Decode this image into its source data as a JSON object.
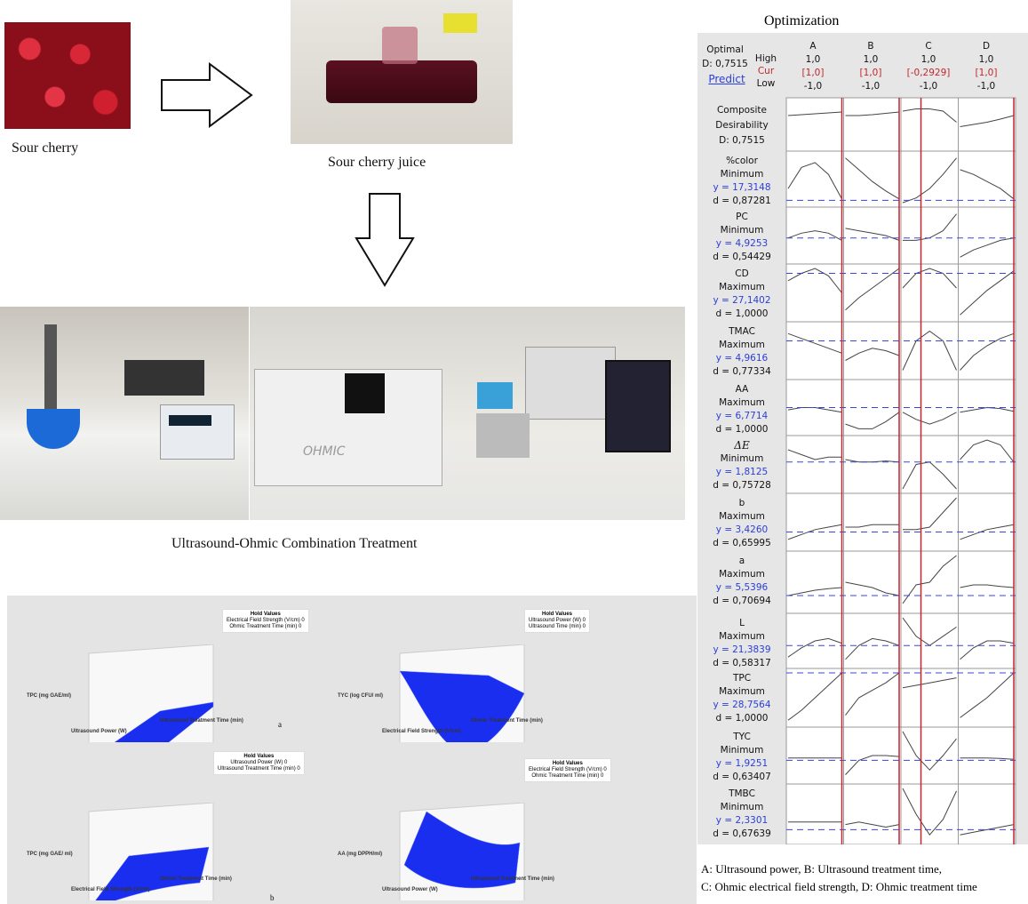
{
  "flow": {
    "sour_cherry": "Sour cherry",
    "juice": "Sour cherry juice",
    "treatment": "Ultrasound-Ohmic Combination Treatment",
    "ohmic_label": "OHMIC"
  },
  "optimization": {
    "title": "Optimization",
    "optimal": "Optimal",
    "D": "D: 0,7515",
    "predict": "Predict",
    "row_labels": {
      "high": "High",
      "cur": "Cur",
      "low": "Low"
    },
    "factors": [
      {
        "name": "A",
        "high": "1,0",
        "cur": "[1,0]",
        "low": "-1,0"
      },
      {
        "name": "B",
        "high": "1,0",
        "cur": "[1,0]",
        "low": "-1,0"
      },
      {
        "name": "C",
        "high": "1,0",
        "cur": "[-0,2929]",
        "low": "-1,0"
      },
      {
        "name": "D",
        "high": "1,0",
        "cur": "[1,0]",
        "low": "-1,0"
      }
    ],
    "composite": {
      "l1": "Composite",
      "l2": "Desirability",
      "l3": "D: 0,7515"
    },
    "responses": [
      {
        "name": "%color",
        "goal": "Minimum",
        "y": "y = 17,3148",
        "d": "d = 0,87281"
      },
      {
        "name": "PC",
        "goal": "Minimum",
        "y": "y = 4,9253",
        "d": "d = 0,54429"
      },
      {
        "name": "CD",
        "goal": "Maximum",
        "y": "y = 27,1402",
        "d": "d = 1,0000"
      },
      {
        "name": "TMAC",
        "goal": "Maximum",
        "y": "y = 4,9616",
        "d": "d = 0,77334"
      },
      {
        "name": "AA",
        "goal": "Maximum",
        "y": "y = 6,7714",
        "d": "d = 1,0000"
      },
      {
        "name": "ΔE",
        "goal": "Minimum",
        "y": "y = 1,8125",
        "d": "d = 0,75728"
      },
      {
        "name": "b",
        "goal": "Maximum",
        "y": "y = 3,4260",
        "d": "d = 0,65995"
      },
      {
        "name": "a",
        "goal": "Maximum",
        "y": "y = 5,5396",
        "d": "d = 0,70694"
      },
      {
        "name": "L",
        "goal": "Maximum",
        "y": "y = 21,3839",
        "d": "d = 0,58317"
      },
      {
        "name": "TPC",
        "goal": "Maximum",
        "y": "y = 28,7564",
        "d": "d = 1,0000"
      },
      {
        "name": "TYC",
        "goal": "Minimum",
        "y": "y = 1,9251",
        "d": "d = 0,63407"
      },
      {
        "name": "TMBC",
        "goal": "Minimum",
        "y": "y = 2,3301",
        "d": "d = 0,67639"
      }
    ],
    "legend1": "A: Ultrasound power, B: Ultrasound treatment time,",
    "legend2": "C: Ohmic electrical field strength, D: Ohmic treatment time",
    "colors": {
      "cur": "#c0272d",
      "y": "#2b3fd6",
      "bg": "#e6e6e6"
    }
  },
  "surfaces": {
    "a_label": "a",
    "b_label": "b",
    "plots": [
      {
        "hold_title": "Hold Values",
        "hold1": "Electrical Field Strength (V/cm)  0",
        "hold2": "Ohmic Treatment Time (min)  0",
        "z": "TPC (mg GAE/ml)",
        "x": "Ultrasound Power (W)",
        "y": "Ultrasound Treatment Time (min)"
      },
      {
        "hold_title": "Hold Values",
        "hold1": "Ultrasound Power (W)  0",
        "hold2": "Ultrasound Time (min)  0",
        "z": "TYC (log CFU/ ml)",
        "x": "Electrical Field Strength (V/cm)",
        "y": "Ohmic Treatment Time (min)"
      },
      {
        "hold_title": "Hold Values",
        "hold1": "Ultrasound Power (W)  0",
        "hold2": "Ultrasound Treatment Time (min)  0",
        "z": "TPC (mg GAE/ ml)",
        "x": "Electrical Field Strength (V/cm)",
        "y": "Ohmic Treatment Time (min)"
      },
      {
        "hold_title": "Hold Values",
        "hold1": "Electrical Field Strength (V/cm)  0",
        "hold2": "Ohmic Treatment Time (min)  0",
        "z": "AA (mg DPPH/ml)",
        "x": "Ultrasound Power (W)",
        "y": "Ultrasound Treatment Time (min)"
      }
    ],
    "surface_color": "#1a2ef0"
  }
}
